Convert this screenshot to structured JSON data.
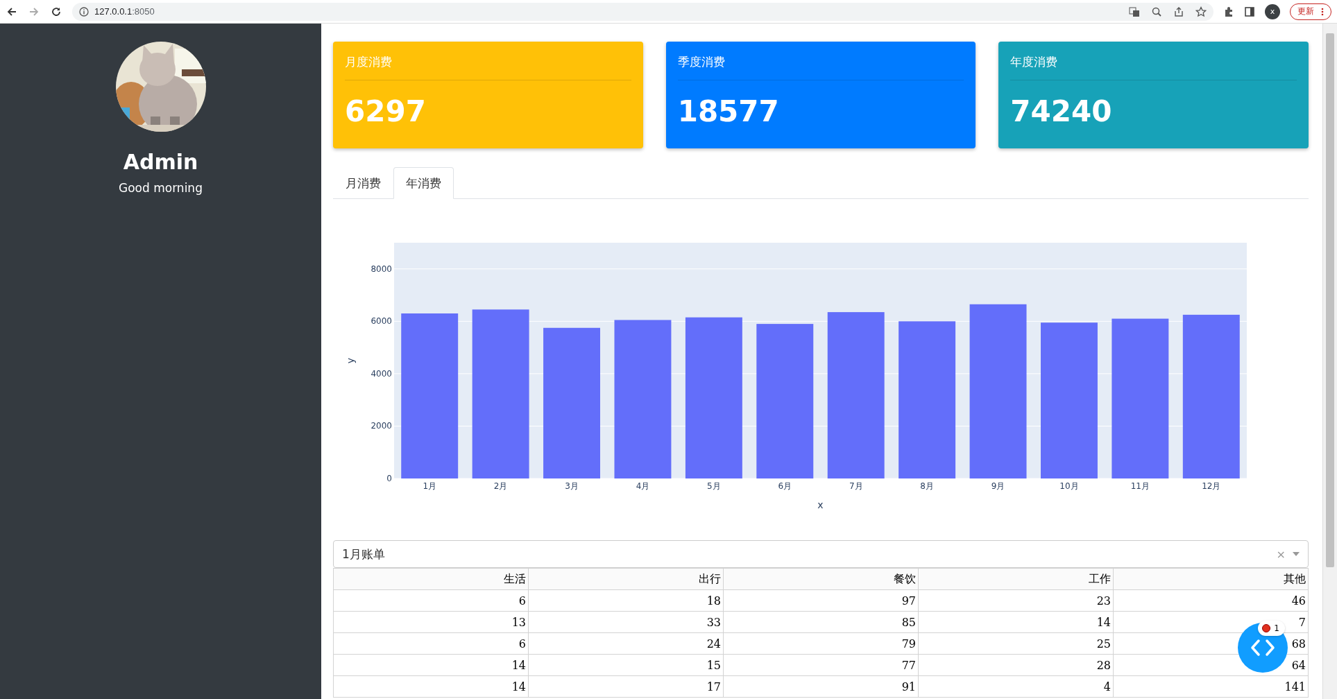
{
  "browser": {
    "url_host": "127.0.0.1",
    "url_port": ":8050",
    "profile": "x",
    "update_button": "更新"
  },
  "sidebar": {
    "name": "Admin",
    "greeting": "Good morning"
  },
  "cards": [
    {
      "title": "月度消费",
      "value": "6297",
      "color": "#ffc107"
    },
    {
      "title": "季度消费",
      "value": "18577",
      "color": "#007bff"
    },
    {
      "title": "年度消费",
      "value": "74240",
      "color": "#17a2b8"
    }
  ],
  "tabs": [
    {
      "label": "月消费",
      "selected": false
    },
    {
      "label": "年消费",
      "selected": true
    }
  ],
  "chart": {
    "chart_data": {
      "type": "bar",
      "xlabel": "x",
      "ylabel": "y",
      "categories": [
        "1月",
        "2月",
        "3月",
        "4月",
        "5月",
        "6月",
        "7月",
        "8月",
        "9月",
        "10月",
        "11月",
        "12月"
      ],
      "series": [
        {
          "color": "#636efa",
          "values": [
            6300,
            6450,
            5750,
            6050,
            6150,
            5900,
            6350,
            6000,
            6650,
            5950,
            6100,
            6250
          ]
        }
      ],
      "grid": true,
      "ylim": [
        0,
        9000
      ],
      "yticks": [
        0,
        2000,
        4000,
        6000,
        8000
      ]
    }
  },
  "dropdown": {
    "value": "1月账单",
    "clear": "×"
  },
  "table": {
    "columns": [
      "生活",
      "出行",
      "餐饮",
      "工作",
      "其他"
    ],
    "rows": [
      [
        "6",
        "18",
        "97",
        "23",
        "46"
      ],
      [
        "13",
        "33",
        "85",
        "14",
        "7"
      ],
      [
        "6",
        "24",
        "79",
        "25",
        "68"
      ],
      [
        "14",
        "15",
        "77",
        "28",
        "64"
      ],
      [
        "14",
        "17",
        "91",
        "4",
        "141"
      ]
    ]
  },
  "debug_badge": {
    "count": "1"
  }
}
